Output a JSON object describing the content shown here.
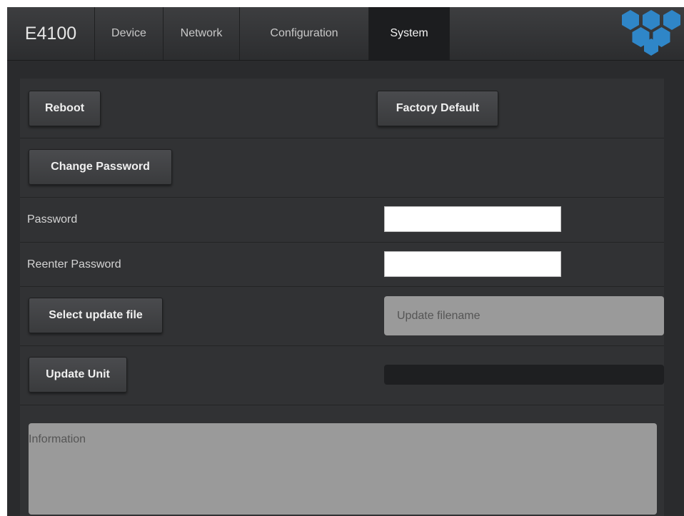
{
  "header": {
    "brand": "E4100",
    "tabs": [
      {
        "label": "Device",
        "active": false
      },
      {
        "label": "Network",
        "active": false
      },
      {
        "label": "Configuration",
        "active": false
      },
      {
        "label": "System",
        "active": true
      }
    ],
    "logo_icon": "hexagon-cluster-logo-icon"
  },
  "system": {
    "reboot_label": "Reboot",
    "factory_default_label": "Factory Default",
    "change_password_label": "Change Password",
    "password_label": "Password",
    "password_value": "",
    "reenter_password_label": "Reenter Password",
    "reenter_password_value": "",
    "select_update_file_label": "Select update file",
    "update_filename_placeholder": "Update filename",
    "update_unit_label": "Update Unit",
    "update_progress": 0,
    "information_placeholder": "Information"
  },
  "colors": {
    "background": "#2a2b2d",
    "panel": "#313234",
    "active_tab": "#1c1d1f",
    "logo_blue": "#2f86c8",
    "field_gray": "#9a9a9a"
  }
}
